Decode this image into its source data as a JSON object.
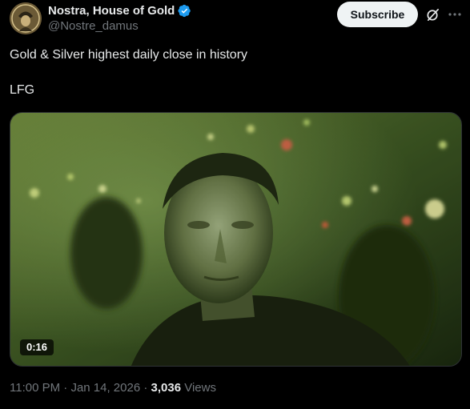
{
  "author": {
    "name": "Nostra, House of Gold",
    "handle": "@Nostre_damus",
    "verified": true
  },
  "header": {
    "subscribe_label": "Subscribe",
    "grok_icon": "grok-slash-icon",
    "more_icon": "more-horizontal-icon"
  },
  "tweet": {
    "line1": "Gold & Silver highest daily close in history",
    "line2": "",
    "line3": "LFG"
  },
  "media": {
    "type": "video",
    "duration": "0:16"
  },
  "meta": {
    "time": "11:00 PM",
    "separator1": " · ",
    "date": "Jan 14, 2026",
    "separator2": " · ",
    "views_count": "3,036",
    "views_label": " Views"
  },
  "colors": {
    "background": "#000000",
    "text_primary": "#e7e9ea",
    "text_secondary": "#71767b",
    "verified_blue": "#1d9bf0",
    "button_bg": "#eff3f4"
  }
}
